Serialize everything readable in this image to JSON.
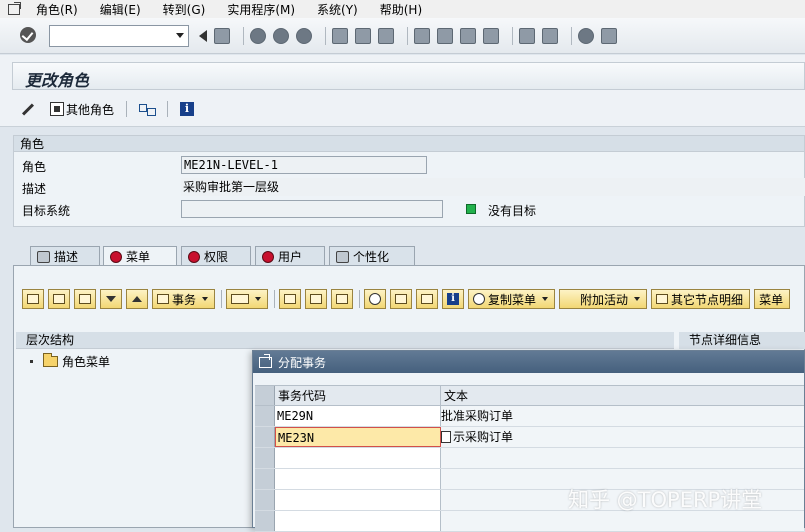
{
  "menubar": {
    "items": [
      "角色(R)",
      "编辑(E)",
      "转到(G)",
      "实用程序(M)",
      "系统(Y)",
      "帮助(H)"
    ]
  },
  "toolbar": {
    "okcode_value": ""
  },
  "page": {
    "title": "更改角色",
    "other_role_label": "其他角色"
  },
  "role_group": {
    "header": "角色",
    "role_label": "角色",
    "role_value": "ME21N-LEVEL-1",
    "desc_label": "描述",
    "desc_value": "采购审批第一层级",
    "target_label": "目标系统",
    "target_value": "",
    "status_text": "没有目标"
  },
  "tabs": [
    {
      "label": "描述",
      "active": false
    },
    {
      "label": "菜单",
      "active": true
    },
    {
      "label": "权限",
      "active": false
    },
    {
      "label": "用户",
      "active": false
    },
    {
      "label": "个性化",
      "active": false
    }
  ],
  "menu_toolbar": {
    "transaction_btn": "事务",
    "copy_menu_btn": "复制菜单",
    "additional_btn": "附加活动",
    "other_node_btn": "其它节点明细",
    "menu_btn": "菜单"
  },
  "hierarchy": {
    "header": "层次结构",
    "root_item": "角色菜单",
    "node_details_header": "节点详细信息"
  },
  "popup": {
    "title": "分配事务",
    "col_code": "事务代码",
    "col_text": "文本",
    "rows": [
      {
        "code": "ME29N",
        "text": "批准采购订单"
      },
      {
        "code": "ME23N",
        "text": "示采购订单"
      },
      {
        "code": "",
        "text": ""
      },
      {
        "code": "",
        "text": ""
      },
      {
        "code": "",
        "text": ""
      },
      {
        "code": "",
        "text": ""
      }
    ]
  },
  "watermark": "知乎 @TOPERP讲堂"
}
